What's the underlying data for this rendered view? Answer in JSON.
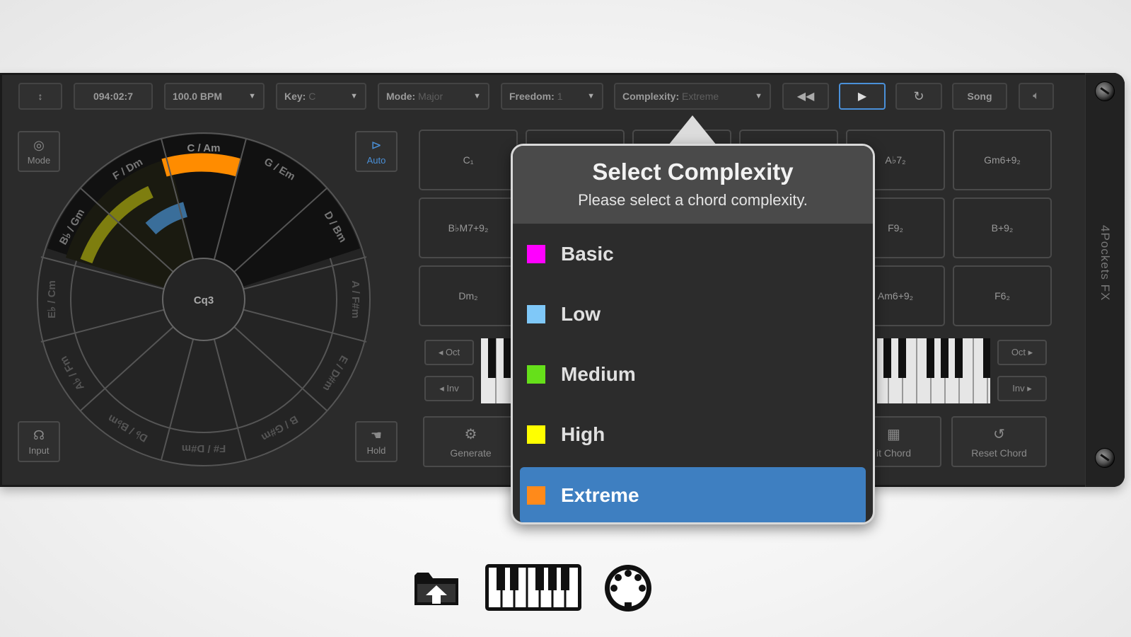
{
  "toolbar": {
    "menu_label": "↕",
    "position": "094:02:7",
    "tempo": "100.0 BPM",
    "key_label": "Key:",
    "key_value": "C",
    "mode_label": "Mode:",
    "mode_value": "Major",
    "freedom_label": "Freedom:",
    "freedom_value": "1",
    "complexity_label": "Complexity:",
    "complexity_value": "Extreme",
    "song_label": "Song"
  },
  "side_buttons": {
    "mode": "Mode",
    "auto": "Auto",
    "input": "Input",
    "hold": "Hold"
  },
  "wheel": {
    "center": "Cq3",
    "segments": [
      "C / Am",
      "G / Em",
      "D / Bm",
      "A / F#m",
      "E / D#m",
      "B / G#m",
      "F# / D#m",
      "D♭ / B♭m",
      "A♭ / Fm",
      "E♭ / Cm",
      "B♭ / Gm",
      "F / Dm"
    ]
  },
  "pads": [
    "C₁",
    "",
    "",
    "",
    "A♭7₂",
    "Gm6+9₂",
    "B♭M7+9₂",
    "",
    "",
    "",
    "F9₂",
    "B+9₂",
    "Dm₂",
    "",
    "",
    "",
    "Am6+9₂",
    "F6₂"
  ],
  "octave": {
    "oct_down": "◂ Oct",
    "inv_down": "◂ Inv",
    "oct_up": "Oct ▸",
    "inv_up": "Inv ▸"
  },
  "actions": {
    "generate": "Generate",
    "edit_chord": "it Chord",
    "reset_chord": "Reset Chord"
  },
  "brand": "4Pockets FX",
  "popup": {
    "title": "Select Complexity",
    "subtitle": "Please select a chord complexity.",
    "options": [
      {
        "label": "Basic",
        "color": "#ff00ff"
      },
      {
        "label": "Low",
        "color": "#7fc8f8"
      },
      {
        "label": "Medium",
        "color": "#66e01a"
      },
      {
        "label": "High",
        "color": "#ffff00"
      },
      {
        "label": "Extreme",
        "color": "#ff8a1a"
      }
    ],
    "selected": "Extreme"
  },
  "dock": {
    "icons": [
      "folder-icon",
      "piano-keyboard-icon",
      "midi-port-icon"
    ]
  }
}
